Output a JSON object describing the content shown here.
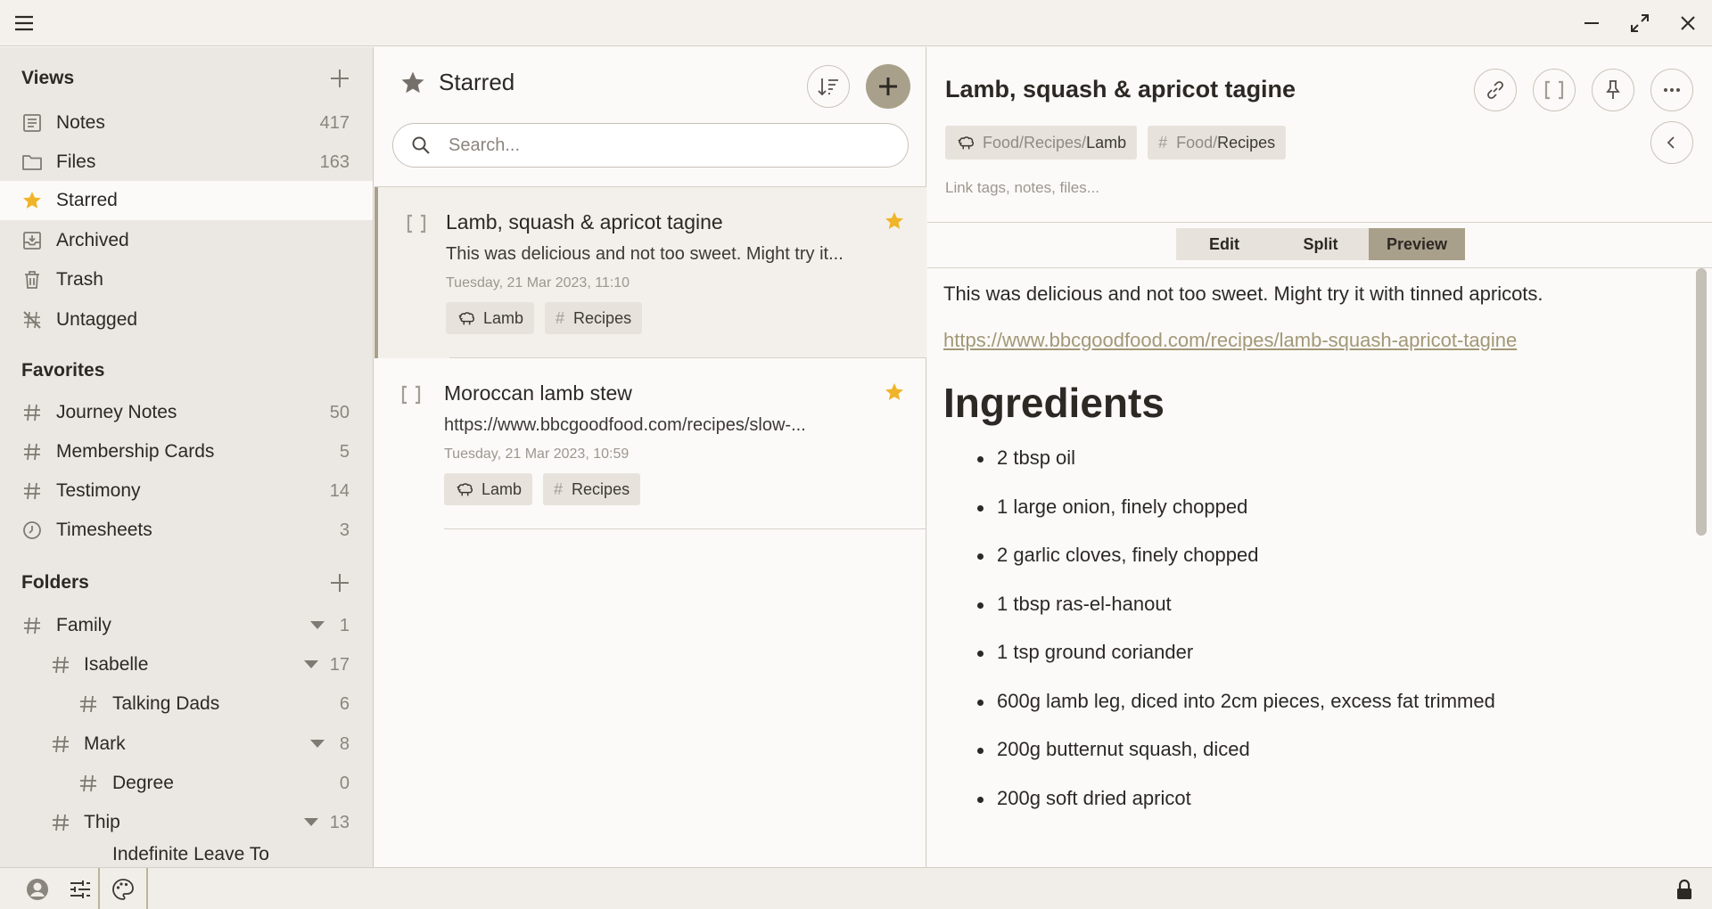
{
  "sidebar": {
    "views_header": "Views",
    "views": [
      {
        "label": "Notes",
        "count": "417"
      },
      {
        "label": "Files",
        "count": "163"
      },
      {
        "label": "Starred",
        "count": ""
      },
      {
        "label": "Archived",
        "count": ""
      },
      {
        "label": "Trash",
        "count": ""
      },
      {
        "label": "Untagged",
        "count": ""
      }
    ],
    "favorites_header": "Favorites",
    "favorites": [
      {
        "label": "Journey Notes",
        "count": "50"
      },
      {
        "label": "Membership Cards",
        "count": "5"
      },
      {
        "label": "Testimony",
        "count": "14"
      },
      {
        "label": "Timesheets",
        "count": "3"
      }
    ],
    "folders_header": "Folders",
    "folders": [
      {
        "label": "Family",
        "count": "1"
      },
      {
        "label": "Isabelle",
        "count": "17"
      },
      {
        "label": "Talking Dads",
        "count": "6"
      },
      {
        "label": "Mark",
        "count": "8"
      },
      {
        "label": "Degree",
        "count": "0"
      },
      {
        "label": "Thip",
        "count": "13"
      },
      {
        "label": "Indefinite Leave To",
        "count": ""
      }
    ]
  },
  "list": {
    "title": "Starred",
    "search_placeholder": "Search...",
    "notes": [
      {
        "title": "Lamb, squash & apricot tagine",
        "preview": "This was delicious and not too sweet. Might try it...",
        "date": "Tuesday, 21 Mar 2023, 11:10",
        "tags": [
          "Lamb",
          "Recipes"
        ]
      },
      {
        "title": "Moroccan lamb stew",
        "preview": "https://www.bbcgoodfood.com/recipes/slow-...",
        "date": "Tuesday, 21 Mar 2023, 10:59",
        "tags": [
          "Lamb",
          "Recipes"
        ]
      }
    ]
  },
  "editor": {
    "title": "Lamb, squash & apricot tagine",
    "tag1_prefix": "Food/Recipes/",
    "tag1_leaf": "Lamb",
    "tag2_prefix": "Food/",
    "tag2_leaf": "Recipes",
    "link_placeholder": "Link tags, notes, files...",
    "modes": [
      "Edit",
      "Split",
      "Preview"
    ],
    "active_mode": "Preview",
    "intro": "This was delicious and not too sweet. Might try it with tinned apricots.",
    "url": "https://www.bbcgoodfood.com/recipes/lamb-squash-apricot-tagine",
    "heading": "Ingredients",
    "ingredients": [
      "2 tbsp oil",
      "1 large onion, finely chopped",
      "2 garlic cloves, finely chopped",
      "1 tbsp ras-el-hanout",
      "1 tsp ground coriander",
      "600g lamb leg, diced into 2cm pieces, excess fat trimmed",
      "200g butternut squash, diced",
      "200g soft dried apricot"
    ]
  },
  "colors": {
    "accent": "#a9a08b",
    "star": "#f0b429",
    "sidebar_bg": "#ebe8e3",
    "panel_bg": "#fbfaf8",
    "link": "#a29777"
  },
  "icons": [
    "hamburger-icon",
    "minimize-icon",
    "maximize-icon",
    "close-icon",
    "notes-icon",
    "folder-icon",
    "star-icon",
    "archive-icon",
    "trash-icon",
    "untagged-icon",
    "hash-icon",
    "clock-icon",
    "plus-icon",
    "sort-icon",
    "search-icon",
    "bracket-icon",
    "sheep-icon",
    "link-icon",
    "pin-icon",
    "more-icon",
    "chevron-left-icon",
    "user-icon",
    "sliders-icon",
    "palette-icon",
    "lock-icon"
  ]
}
